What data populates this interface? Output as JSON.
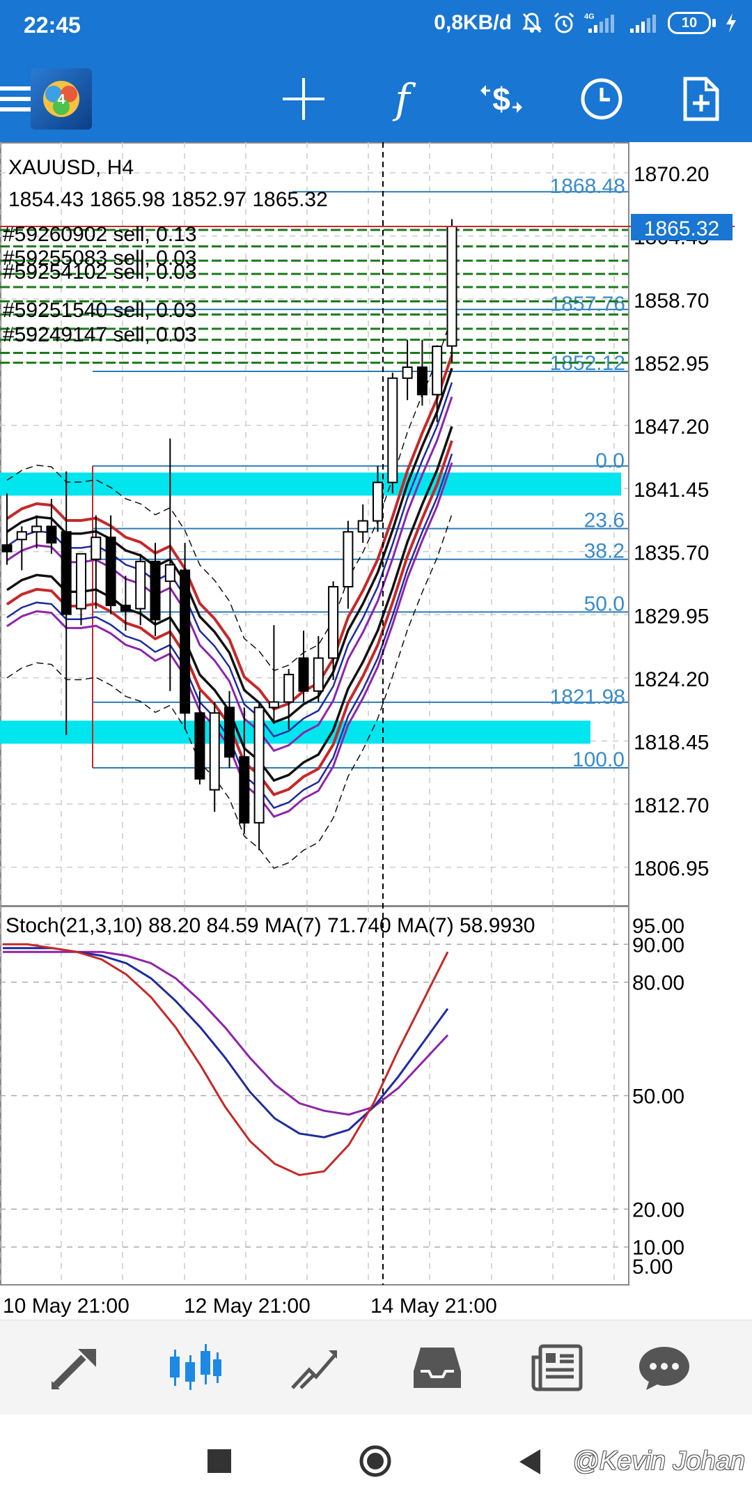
{
  "status_bar": {
    "time": "22:45",
    "data_rate": "0,8KB/d",
    "signal_label": "4G",
    "battery_level": "10"
  },
  "toolbar": {
    "icons": [
      "menu-icon",
      "app-logo-icon",
      "crosshair-icon",
      "indicators-icon",
      "trade-icon",
      "timeframe-icon",
      "new-order-icon"
    ]
  },
  "chart": {
    "symbol": "XAUUSD, H4",
    "ohlc": "1854.43 1865.98 1852.97 1865.32",
    "current_price": "1865.32",
    "orders": [
      "#59260902 sell, 0.13",
      "#59255083 sell, 0.03",
      "#59254102 sell, 0.03",
      "#59251540 sell, 0.03",
      "#59249147 sell, 0.03"
    ],
    "price_axis": [
      "1870.20",
      "1864.45",
      "1858.70",
      "1852.95",
      "1847.20",
      "1841.45",
      "1835.70",
      "1829.95",
      "1824.20",
      "1818.45",
      "1812.70",
      "1806.95"
    ],
    "hline_labels": [
      "1868.48",
      "1857.76",
      "1852.12",
      "1821.98"
    ],
    "fibo_labels": [
      "0.0",
      "23.6",
      "38.2",
      "50.0",
      "100.0"
    ],
    "stoch_label": "Stoch(21,3,10) 88.20 84.59 MA(7) 71.740 MA(7) 58.9930",
    "stoch_axis": [
      "95.00",
      "90.00",
      "80.00",
      "50.00",
      "20.00",
      "10.00",
      "5.00"
    ],
    "time_axis": [
      "10 May 21:00",
      "12 May 21:00",
      "14 May 21:00"
    ],
    "colors": {
      "fibo_zone": "#00E5EE",
      "order_lines": "#1B7A1B",
      "price_tag": "#1976D2",
      "axis_label": "#3A8CC9"
    }
  },
  "chart_data": {
    "type": "candlestick",
    "symbol": "XAUUSD",
    "timeframe": "H4",
    "ylim": [
      1803.5,
      1873.0
    ],
    "candles": [
      {
        "o": 1836.3,
        "h": 1841.0,
        "l": 1834.5,
        "c": 1835.7
      },
      {
        "o": 1836.8,
        "h": 1838.0,
        "l": 1834.0,
        "c": 1837.5
      },
      {
        "o": 1837.5,
        "h": 1839.0,
        "l": 1836.0,
        "c": 1838.0
      },
      {
        "o": 1838.0,
        "h": 1840.5,
        "l": 1835.5,
        "c": 1836.5
      },
      {
        "o": 1837.5,
        "h": 1843.0,
        "l": 1819.0,
        "c": 1830.0
      },
      {
        "o": 1830.5,
        "h": 1835.5,
        "l": 1829.0,
        "c": 1835.5
      },
      {
        "o": 1835.0,
        "h": 1839.0,
        "l": 1830.5,
        "c": 1837.0
      },
      {
        "o": 1837.0,
        "h": 1839.0,
        "l": 1830.0,
        "c": 1830.8
      },
      {
        "o": 1830.8,
        "h": 1833.5,
        "l": 1828.5,
        "c": 1830.3
      },
      {
        "o": 1830.5,
        "h": 1835.5,
        "l": 1829.0,
        "c": 1834.8
      },
      {
        "o": 1834.8,
        "h": 1836.5,
        "l": 1828.0,
        "c": 1829.5
      },
      {
        "o": 1833.0,
        "h": 1846.0,
        "l": 1823.0,
        "c": 1834.5
      },
      {
        "o": 1834.0,
        "h": 1836.5,
        "l": 1819.5,
        "c": 1821.0
      },
      {
        "o": 1821.0,
        "h": 1823.0,
        "l": 1814.5,
        "c": 1815.0
      },
      {
        "o": 1814.0,
        "h": 1822.0,
        "l": 1812.0,
        "c": 1821.0
      },
      {
        "o": 1821.5,
        "h": 1823.0,
        "l": 1816.0,
        "c": 1817.0
      },
      {
        "o": 1817.0,
        "h": 1821.5,
        "l": 1810.0,
        "c": 1811.0
      },
      {
        "o": 1811.0,
        "h": 1822.0,
        "l": 1808.5,
        "c": 1821.5
      },
      {
        "o": 1821.5,
        "h": 1829.0,
        "l": 1820.0,
        "c": 1822.0
      },
      {
        "o": 1822.0,
        "h": 1825.0,
        "l": 1819.5,
        "c": 1824.5
      },
      {
        "o": 1826.0,
        "h": 1828.5,
        "l": 1822.0,
        "c": 1823.0
      },
      {
        "o": 1823.0,
        "h": 1828.0,
        "l": 1822.0,
        "c": 1826.0
      },
      {
        "o": 1826.0,
        "h": 1833.0,
        "l": 1824.0,
        "c": 1832.5
      },
      {
        "o": 1832.5,
        "h": 1838.5,
        "l": 1830.5,
        "c": 1837.5
      },
      {
        "o": 1837.5,
        "h": 1840.0,
        "l": 1836.5,
        "c": 1838.5
      },
      {
        "o": 1838.5,
        "h": 1843.5,
        "l": 1837.5,
        "c": 1842.0
      },
      {
        "o": 1842.0,
        "h": 1852.0,
        "l": 1841.0,
        "c": 1851.5
      },
      {
        "o": 1851.5,
        "h": 1855.0,
        "l": 1849.5,
        "c": 1852.5
      },
      {
        "o": 1852.5,
        "h": 1855.0,
        "l": 1849.0,
        "c": 1850.0
      },
      {
        "o": 1850.0,
        "h": 1854.5,
        "l": 1847.5,
        "c": 1854.4
      },
      {
        "o": 1854.43,
        "h": 1865.98,
        "l": 1852.97,
        "c": 1865.32
      }
    ],
    "stochastic": {
      "name": "Stoch(21,3,10)",
      "main": 88.2,
      "signal": 84.59,
      "ma1": 71.74,
      "ma2": 58.993,
      "ylim": [
        0,
        100
      ]
    },
    "x_labels": [
      "10 May 21:00",
      "12 May 21:00",
      "14 May 21:00"
    ]
  },
  "bottom_nav": {
    "items": [
      "quotes-icon",
      "chart-icon",
      "trade-icon",
      "history-icon",
      "news-icon",
      "chat-icon"
    ],
    "active": "chart-icon"
  },
  "system_nav": {
    "watermark": "@Kevin Johan"
  }
}
